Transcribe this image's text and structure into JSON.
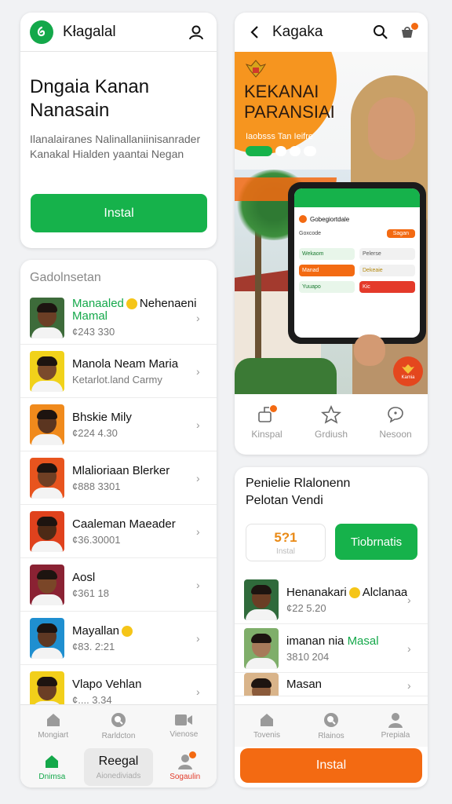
{
  "left_top": {
    "title": "Kłagalal",
    "heading": "Dngaia Kanan Nanasain",
    "description": "Ilanalairanes Nalinallaniinisanrader Kanakal Hialden yaantai Negan",
    "button": "Instal"
  },
  "contacts": {
    "section": "Gadolnsetan",
    "items": [
      {
        "name_a": "Manaaled",
        "name_b": "Nehenaeni",
        "name_c": "Mamal",
        "sub": "¢243 330",
        "skin": "#6b3e25",
        "bg": "#3d6b3a"
      },
      {
        "name": "Manola Neam Maria",
        "sub": "Ketarlot.land Carmy",
        "skin": "#7a4a2c",
        "bg": "#f1d21a"
      },
      {
        "name": "Bhskie Mily",
        "sub": "¢224 4.30",
        "skin": "#5b3520",
        "bg": "#f08a1c"
      },
      {
        "name": "Mlalioriaan Blerker",
        "sub": "¢888 3301",
        "skin": "#6f3f24",
        "bg": "#e8541e"
      },
      {
        "name": "Caaleman Maeader",
        "sub": "¢36.30001",
        "skin": "#4d2a16",
        "bg": "#e0421d"
      },
      {
        "name": "Aosl",
        "sub": "¢361 18",
        "skin": "#7a4628",
        "bg": "#8a2233"
      },
      {
        "name": "Mayallan",
        "sub": "¢83. 2:21",
        "skin": "#5e3823",
        "bg": "#1f8fd0"
      },
      {
        "name": "Vlapo Vehlan",
        "sub": "¢.... 3.34",
        "skin": "#6b3e25",
        "bg": "#f2cf1a"
      }
    ]
  },
  "left_tabs": {
    "top": [
      {
        "label": "Mongiart",
        "icon": "home-icon"
      },
      {
        "label": "Rarldcton",
        "icon": "search-icon"
      },
      {
        "label": "Vienose",
        "icon": "video-icon"
      }
    ],
    "bottom": [
      {
        "label": "Dnimsa",
        "icon": "home-icon"
      },
      {
        "label": "Reegal",
        "sub": "Aionediviads"
      },
      {
        "label": "Sogaulin",
        "icon": "profile-icon"
      }
    ]
  },
  "right_top": {
    "title": "Kagaka",
    "banner_title": "KEKANAI PARANSIAI",
    "banner_sub": "Iaobsss Tan Ieifre",
    "phone": {
      "title": "Gobegiortdale",
      "row1": "Goxcode",
      "row1_btn": "Sagan",
      "c1": "Wekaom",
      "c2": "Pelerse",
      "c3": "Manad",
      "c4": "Dekeaie",
      "c5": "Yuuapo",
      "c6": "Kic"
    },
    "badge_text": "Kamia",
    "actions": [
      {
        "label": "Kinspal",
        "icon": "share-icon"
      },
      {
        "label": "Grdiush",
        "icon": "star-icon"
      },
      {
        "label": "Nesoon",
        "icon": "chat-icon"
      }
    ]
  },
  "right_bottom": {
    "title": "Penielie Rlalonenn Pelotan Vendi",
    "stat_value": "5?1",
    "stat_label": "Instal",
    "stat_button": "Tiobrnatis",
    "items": [
      {
        "name_a": "Henanakari",
        "name_b": "Alclanaani",
        "sub": "¢22 5.20",
        "skin": "#6b3e25",
        "bg": "#2f6a3b"
      },
      {
        "name_a": "imanan nia",
        "name_b": "Masal",
        "sub": "3810 204",
        "skin": "#a77a5a",
        "bg": "#7fae6a"
      },
      {
        "name": "Masan",
        "sub": "",
        "skin": "#8a5a3a",
        "bg": "#d9b48a"
      }
    ],
    "tabs": [
      {
        "label": "Tovenis",
        "icon": "home-icon"
      },
      {
        "label": "Rlainos",
        "icon": "search-icon"
      },
      {
        "label": "Prepiala",
        "icon": "profile-icon"
      }
    ],
    "button": "Instal"
  }
}
